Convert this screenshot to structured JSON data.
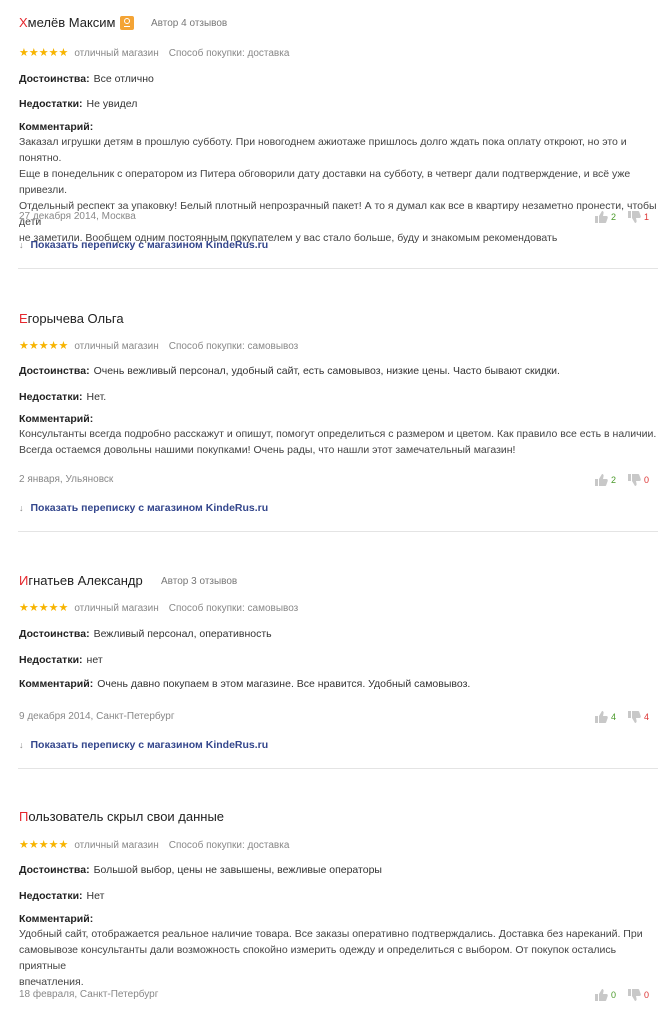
{
  "colors": {
    "accent_initial": "#e5272d",
    "stars": "#f7b400",
    "link": "#33468c",
    "vote_up": "#4a9a2a",
    "vote_down": "#dd3333",
    "ok_badge": "#f4a435"
  },
  "labels": {
    "pros": "Достоинства:",
    "cons": "Недостатки:",
    "comment": "Комментарий:",
    "stars": "★★★★★",
    "show_chat": "Показать переписку с магазином KindeRus.ru",
    "chat_arrow": "↓"
  },
  "reviews": [
    {
      "author_initial": "Х",
      "author_rest": "мелёв Максим",
      "has_ok_icon": true,
      "author_note": "Автор 4 отзывов",
      "grade": "отличный магазин",
      "purchase": "Способ покупки: доставка",
      "pros": "Все отлично",
      "cons": "Не увидел",
      "comment_lines": [
        "Заказал игрушки детям в прошлую субботу. При новогоднем ажиотаже пришлось долго ждать пока оплату откроют, но это и понятно.",
        "Еще в понедельник с оператором из Питера обговорили дату доставки на субботу, в четверг дали подтверждение, и всё уже привезли.",
        "Отдельный респект за упаковку! Белый плотный непрозрачный пакет! А то я думал как все в квартиру незаметно пронести, чтобы дети",
        "не заметили. Вообщем одним постоянным покупателем у вас стало больше, буду и знакомым рекомендовать"
      ],
      "comment_inline": false,
      "date_city": "27 декабря 2014, Москва",
      "votes_up": "2",
      "votes_down": "1"
    },
    {
      "author_initial": "Е",
      "author_rest": "горычева Ольга",
      "has_ok_icon": false,
      "author_note": "",
      "grade": "отличный магазин",
      "purchase": "Способ покупки: самовывоз",
      "pros": "Очень вежливый персонал, удобный сайт, есть самовывоз, низкие цены. Часто бывают скидки.",
      "cons": "Нет.",
      "comment_lines": [
        "Консультанты всегда подробно расскажут и опишут, помогут определиться с размером и цветом. Как правило все есть в наличии.",
        "Всегда остаемся довольны нашими покупками! Очень рады, что нашли этот замечательный магазин!"
      ],
      "comment_inline": false,
      "date_city": "2 января, Ульяновск",
      "votes_up": "2",
      "votes_down": "0"
    },
    {
      "author_initial": "И",
      "author_rest": "гнатьев Александр",
      "has_ok_icon": false,
      "author_note": "Автор 3 отзывов",
      "grade": "отличный магазин",
      "purchase": "Способ покупки: самовывоз",
      "pros": "Вежливый персонал, оперативность",
      "cons": "нет",
      "comment_lines": [
        "Очень давно покупаем в этом магазине. Все нравится. Удобный самовывоз."
      ],
      "comment_inline": true,
      "date_city": "9 декабря 2014, Санкт-Петербург",
      "votes_up": "4",
      "votes_down": "4"
    },
    {
      "author_initial": "П",
      "author_rest": "ользователь скрыл свои данные",
      "has_ok_icon": false,
      "author_note": "",
      "grade": "отличный магазин",
      "purchase": "Способ покупки: доставка",
      "pros": "Большой выбор, цены не завышены, вежливые операторы",
      "cons": "Нет",
      "comment_lines": [
        "Удобный сайт, отображается реальное наличие товара. Все заказы оперативно подтверждались. Доставка без нареканий. При",
        "самовывозе консультанты дали возможность спокойно измерить одежду и определиться с выбором. От покупок остались приятные",
        "впечатления."
      ],
      "comment_inline": false,
      "date_city": "18 февраля, Санкт-Петербург",
      "votes_up": "0",
      "votes_down": "0"
    }
  ]
}
